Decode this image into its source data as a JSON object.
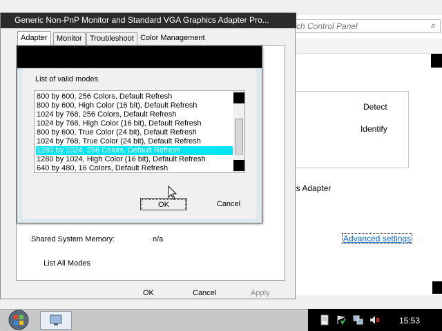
{
  "background_window": {
    "search_placeholder": "ch Control Panel",
    "detect_label": "Detect",
    "identify_label": "Identify",
    "adapter_text": "ics Adapter",
    "advanced_settings_link": "Advanced settings"
  },
  "properties_window": {
    "title": "Generic Non-PnP Monitor and Standard VGA Graphics Adapter Pro...",
    "tabs": [
      {
        "label": "Adapter",
        "active": true
      },
      {
        "label": "Monitor",
        "active": false
      },
      {
        "label": "Troubleshoot",
        "active": false
      },
      {
        "label": "Color Management",
        "active": false
      }
    ],
    "shared_memory_label": "Shared System Memory:",
    "shared_memory_value": "n/a",
    "list_all_modes_button": "List All Modes",
    "ok_button": "OK",
    "cancel_button": "Cancel",
    "apply_button": "Apply"
  },
  "modes_dialog": {
    "heading": "List of valid modes",
    "modes": [
      "800 by 600, 256 Colors, Default Refresh",
      "800 by 600, High Color (16 bit), Default Refresh",
      "1024 by 768, 256 Colors, Default Refresh",
      "1024 by 768, High Color (16 bit), Default Refresh",
      "800 by 600, True Color (24 bit), Default Refresh",
      "1024 by 768, True Color (24 bit), Default Refresh",
      "1280 by 1024, 256 Colors, Default Refresh",
      "1280 by 1024, High Color (16 bit), Default Refresh",
      "640 by 480, 16 Colors, Default Refresh"
    ],
    "selected_index": 6,
    "ok_button": "OK",
    "cancel_button": "Cancel"
  },
  "taskbar": {
    "clock": "15:53"
  },
  "colors": {
    "selection": "#00e5f2",
    "link": "#0066cc",
    "titlebar": "#2b2b2b"
  }
}
